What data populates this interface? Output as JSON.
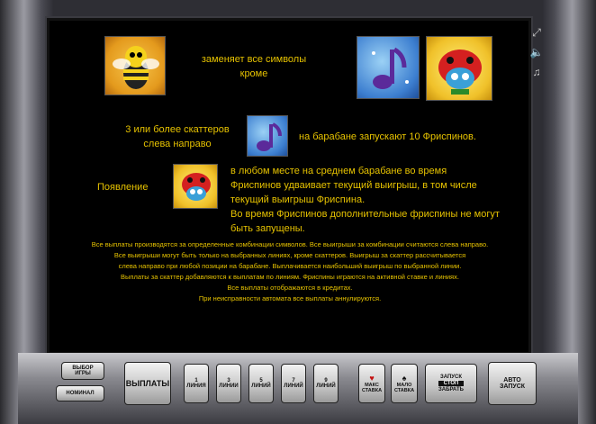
{
  "paytable": {
    "wild_text": "заменяет все символы\nкроме",
    "scatter_text": "3 или более скаттеров\nслева направо",
    "scatter_result": "на барабане запускают 10 Фриспинов.",
    "appearance_label": "Появление",
    "appearance_text": "в любом месте на среднем барабане во время\nФриспинов удваивает текущий выигрыш, в том числе\nтекущий выигрыш Фриспина.\nВо время Фриспинов дополнительные фриспины не могут\nбыть запущены.",
    "rules": [
      "Все выплаты производятся за определенные комбинации символов. Все выигрыши за комбинации считаются слева направо.",
      "Все выигрыши могут быть только на выбранных линиях, кроме скаттеров. Выигрыш за скаттер рассчитывается",
      "слева направо при любой позиции на барабане. Выплачивается наибольший выигрыш по выбранной линии.",
      "Выплаты за скаттер добавляются к выплатам по линиям. Фриспины играются на активной ставке и линиях.",
      "Все выплаты отображаются в кредитах.",
      "При неисправности автомата все выплаты аннулируются."
    ]
  },
  "symbols": {
    "wild": "bee-icon",
    "exceptions": [
      "music-note-icon",
      "ladybug-icon"
    ],
    "scatter": "music-note-icon",
    "multiplier": "ladybug-icon"
  },
  "side_icons": [
    "fullscreen-icon",
    "sound-icon",
    "music-icon"
  ],
  "panel": {
    "select_game": [
      "ВЫБОР",
      "ИГРЫ"
    ],
    "denomination": "НОМИНАЛ",
    "payouts": "ВЫПЛАТЫ",
    "lines": [
      {
        "num": "1",
        "label": "ЛИНИЯ"
      },
      {
        "num": "3",
        "label": "ЛИНИИ"
      },
      {
        "num": "5",
        "label": "ЛИНИЙ"
      },
      {
        "num": "7",
        "label": "ЛИНИЙ"
      },
      {
        "num": "9",
        "label": "ЛИНИЙ"
      }
    ],
    "max_bet": [
      "МАКС",
      "СТАВКА"
    ],
    "min_bet": [
      "МАЛО",
      "СТАВКА"
    ],
    "start_stop": [
      "ЗАПУСК",
      "СТОП",
      "ЗАБРАТЬ"
    ],
    "auto": [
      "АВТО",
      "ЗАПУСК"
    ]
  },
  "colors": {
    "text": "#e6c200",
    "screen": "#000000"
  }
}
